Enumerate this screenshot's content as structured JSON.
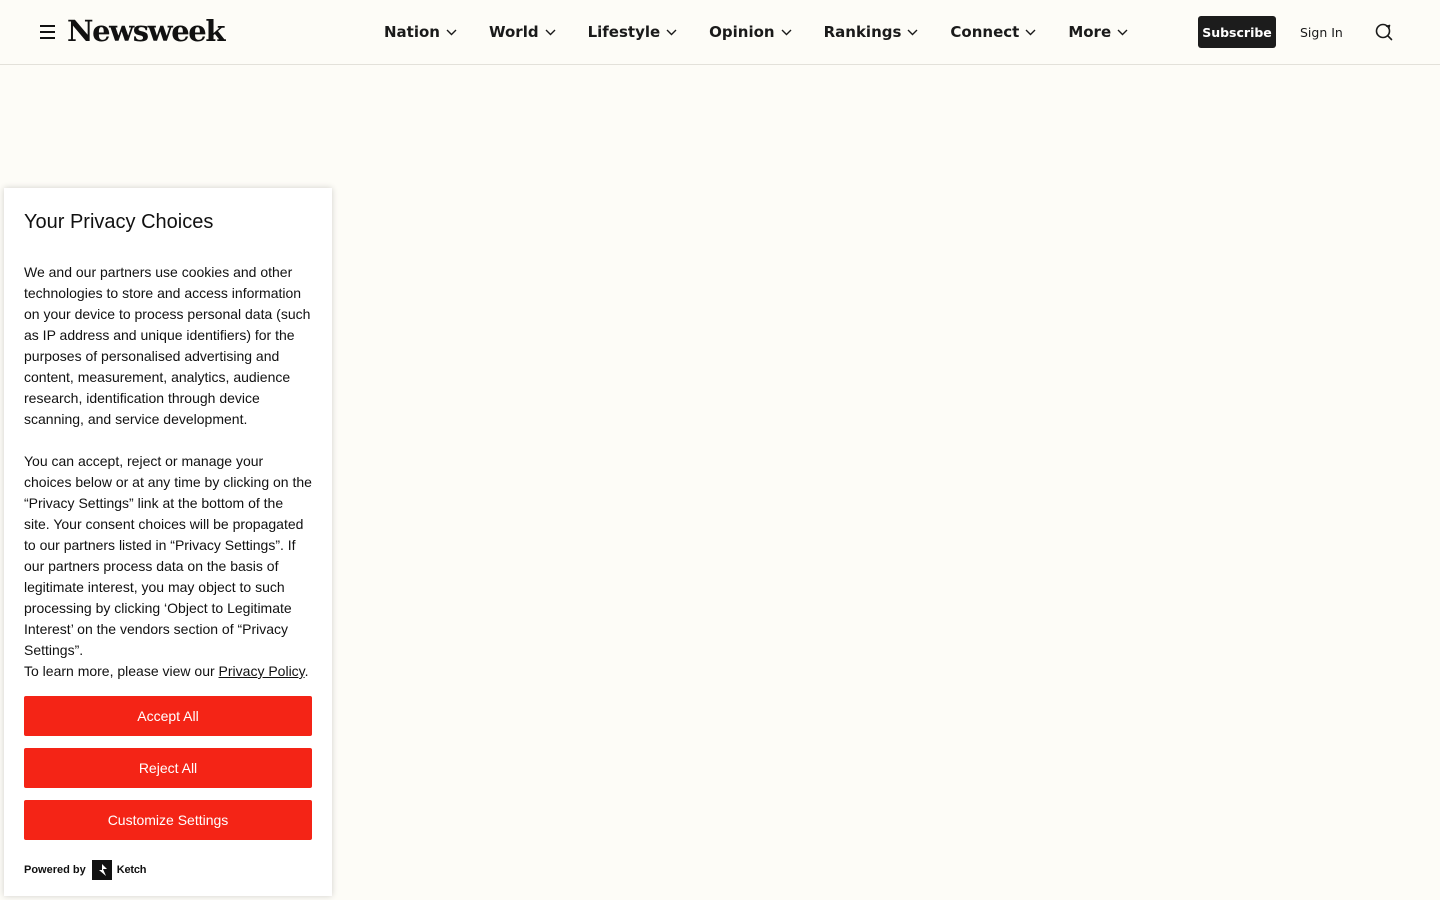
{
  "header": {
    "logo": "Newsweek",
    "nav": [
      {
        "label": "Nation"
      },
      {
        "label": "World"
      },
      {
        "label": "Lifestyle"
      },
      {
        "label": "Opinion"
      },
      {
        "label": "Rankings"
      },
      {
        "label": "Connect"
      },
      {
        "label": "More"
      }
    ],
    "subscribe_label": "Subscribe",
    "signin_label": "Sign In"
  },
  "privacy": {
    "title": "Your Privacy Choices",
    "paragraph1": "We and our partners use cookies and other technologies to store and access information on your device to process personal data (such as IP address and unique identifiers) for the purposes of personalised advertising and content, measurement, analytics, audience research, identification through device scanning, and service development.",
    "paragraph2": "You can accept, reject or manage your choices below or at any time by clicking on the “Privacy Settings” link at the bottom of the site. Your consent choices will be propagated to our partners listed in “Privacy Settings”. If our partners process data on the basis of legitimate interest, you may object to such processing by clicking ‘Object to Legitimate Interest’ on the vendors section of “Privacy Settings”.",
    "learn_more_prefix": "To learn more, please view our ",
    "privacy_policy_link": "Privacy Policy",
    "learn_more_suffix": ".",
    "accept_label": "Accept All",
    "reject_label": "Reject All",
    "customize_label": "Customize Settings",
    "powered_by": "Powered by",
    "ketch_name": "Ketch"
  },
  "colors": {
    "background": "#fdfcf7",
    "accent_red": "#f42416",
    "subscribe_bg": "#1c1c1c"
  },
  "icons": {
    "menu": "hamburger-menu-icon",
    "nav_chevron": "chevron-down-icon",
    "search": "search-icon",
    "ketch": "ketch-logo-icon"
  }
}
